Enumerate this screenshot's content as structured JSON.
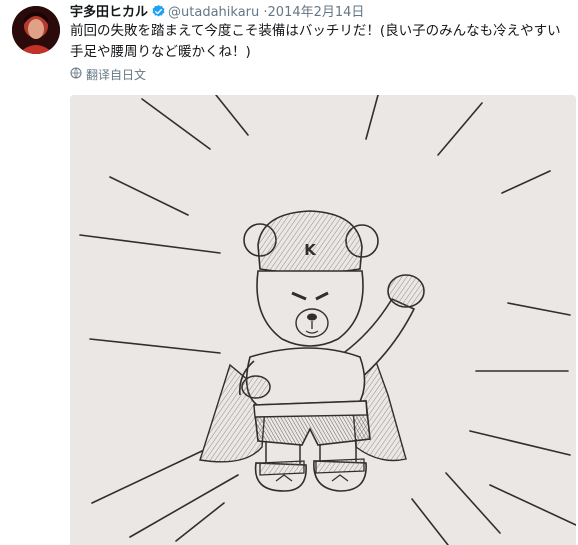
{
  "tweet": {
    "author": {
      "display_name": "宇多田ヒカル",
      "handle": "@utadahikaru",
      "verified": true
    },
    "separator": "·",
    "date": "2014年2月14日",
    "text": "前回の失敗を踏まえて今度こそ装備はバッチリだ！(良い子のみんなも冷えやすい手足や腰周りなど暖かくね！)",
    "translate_label": "翻译自日文",
    "media": {
      "hat_letter": "K"
    }
  },
  "colors": {
    "text": "#14171a",
    "secondary_text": "#657786",
    "verified_badge": "#1da1f2",
    "paper": "#e9e5e2",
    "pencil": "#2f2f2f"
  },
  "icons": {
    "verified": "verified-badge-icon",
    "translate": "globe-icon"
  }
}
